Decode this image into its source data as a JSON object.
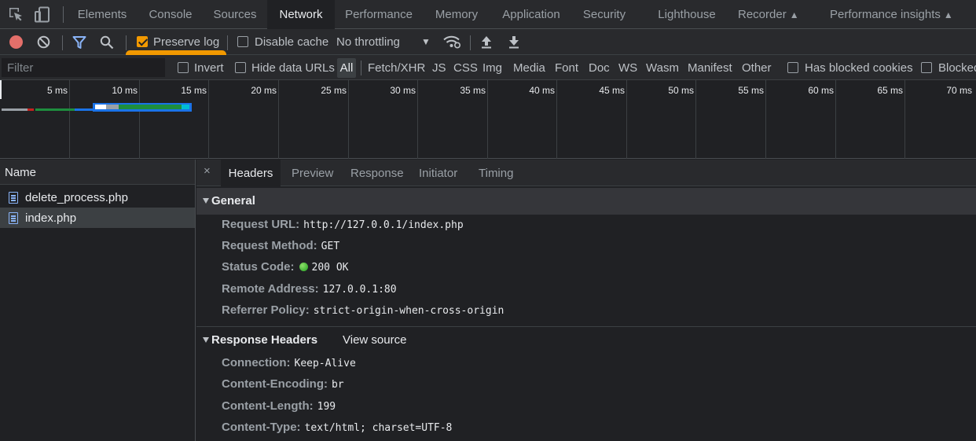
{
  "tabs": [
    {
      "label": "Elements"
    },
    {
      "label": "Console"
    },
    {
      "label": "Sources"
    },
    {
      "label": "Network",
      "active": true
    },
    {
      "label": "Performance"
    },
    {
      "label": "Memory"
    },
    {
      "label": "Application"
    },
    {
      "label": "Security"
    },
    {
      "label": "Lighthouse"
    },
    {
      "label": "Recorder"
    },
    {
      "label": "Performance insights"
    }
  ],
  "toolbar": {
    "preserve_log": {
      "label": "Preserve log",
      "checked": true
    },
    "disable_cache": {
      "label": "Disable cache",
      "checked": false
    },
    "throttling": "No throttling",
    "dropdown_glyph": "▼"
  },
  "filter_bar": {
    "placeholder": "Filter",
    "invert_label": "Invert",
    "hide_data_urls_label": "Hide data URLs",
    "types": [
      "All",
      "Fetch/XHR",
      "JS",
      "CSS",
      "Img",
      "Media",
      "Font",
      "Doc",
      "WS",
      "Wasm",
      "Manifest",
      "Other"
    ],
    "has_blocked_cookies_label": "Has blocked cookies",
    "blocked_label": "Blocked"
  },
  "timeline": {
    "ticks": [
      "5 ms",
      "10 ms",
      "15 ms",
      "20 ms",
      "25 ms",
      "30 ms",
      "35 ms",
      "40 ms",
      "45 ms",
      "50 ms",
      "55 ms",
      "60 ms",
      "65 ms",
      "70 ms"
    ]
  },
  "requests": {
    "header": "Name",
    "items": [
      {
        "name": "delete_process.php"
      },
      {
        "name": "index.php",
        "selected": true
      }
    ]
  },
  "details": {
    "close_glyph": "×",
    "tabs": [
      "Headers",
      "Preview",
      "Response",
      "Initiator",
      "Timing"
    ],
    "general": {
      "title": "General",
      "rows": [
        {
          "key": "Request URL:",
          "value": "http://127.0.0.1/index.php"
        },
        {
          "key": "Request Method:",
          "value": "GET"
        },
        {
          "key": "Status Code:",
          "value": "200 OK"
        },
        {
          "key": "Remote Address:",
          "value": "127.0.0.1:80"
        },
        {
          "key": "Referrer Policy:",
          "value": "strict-origin-when-cross-origin"
        }
      ]
    },
    "response_headers": {
      "title": "Response Headers",
      "view_source": "View source",
      "rows": [
        {
          "key": "Connection:",
          "value": "Keep-Alive"
        },
        {
          "key": "Content-Encoding:",
          "value": "br"
        },
        {
          "key": "Content-Length:",
          "value": "199"
        },
        {
          "key": "Content-Type:",
          "value": "text/html; charset=UTF-8"
        }
      ]
    }
  },
  "colors": {
    "accent_orange": "#f29900",
    "record_red": "#e46f6a",
    "link_blue": "#8ab4f8",
    "status_green": "#1e9e1e"
  }
}
